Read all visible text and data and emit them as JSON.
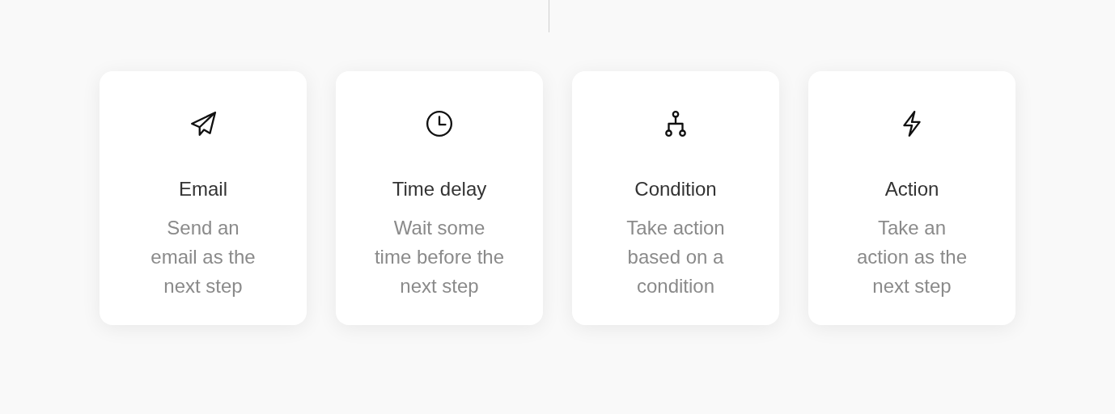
{
  "steps": [
    {
      "kind": "email",
      "title": "Email",
      "description_lines": [
        "Send an",
        "email as the",
        "next step"
      ]
    },
    {
      "kind": "delay",
      "title": "Time delay",
      "description_lines": [
        "Wait some",
        "time before the",
        "next step"
      ]
    },
    {
      "kind": "condition",
      "title": "Condition",
      "description_lines": [
        "Take action",
        "based on a",
        "condition"
      ]
    },
    {
      "kind": "action",
      "title": "Action",
      "description_lines": [
        "Take an",
        "action as the",
        "next step"
      ]
    }
  ]
}
